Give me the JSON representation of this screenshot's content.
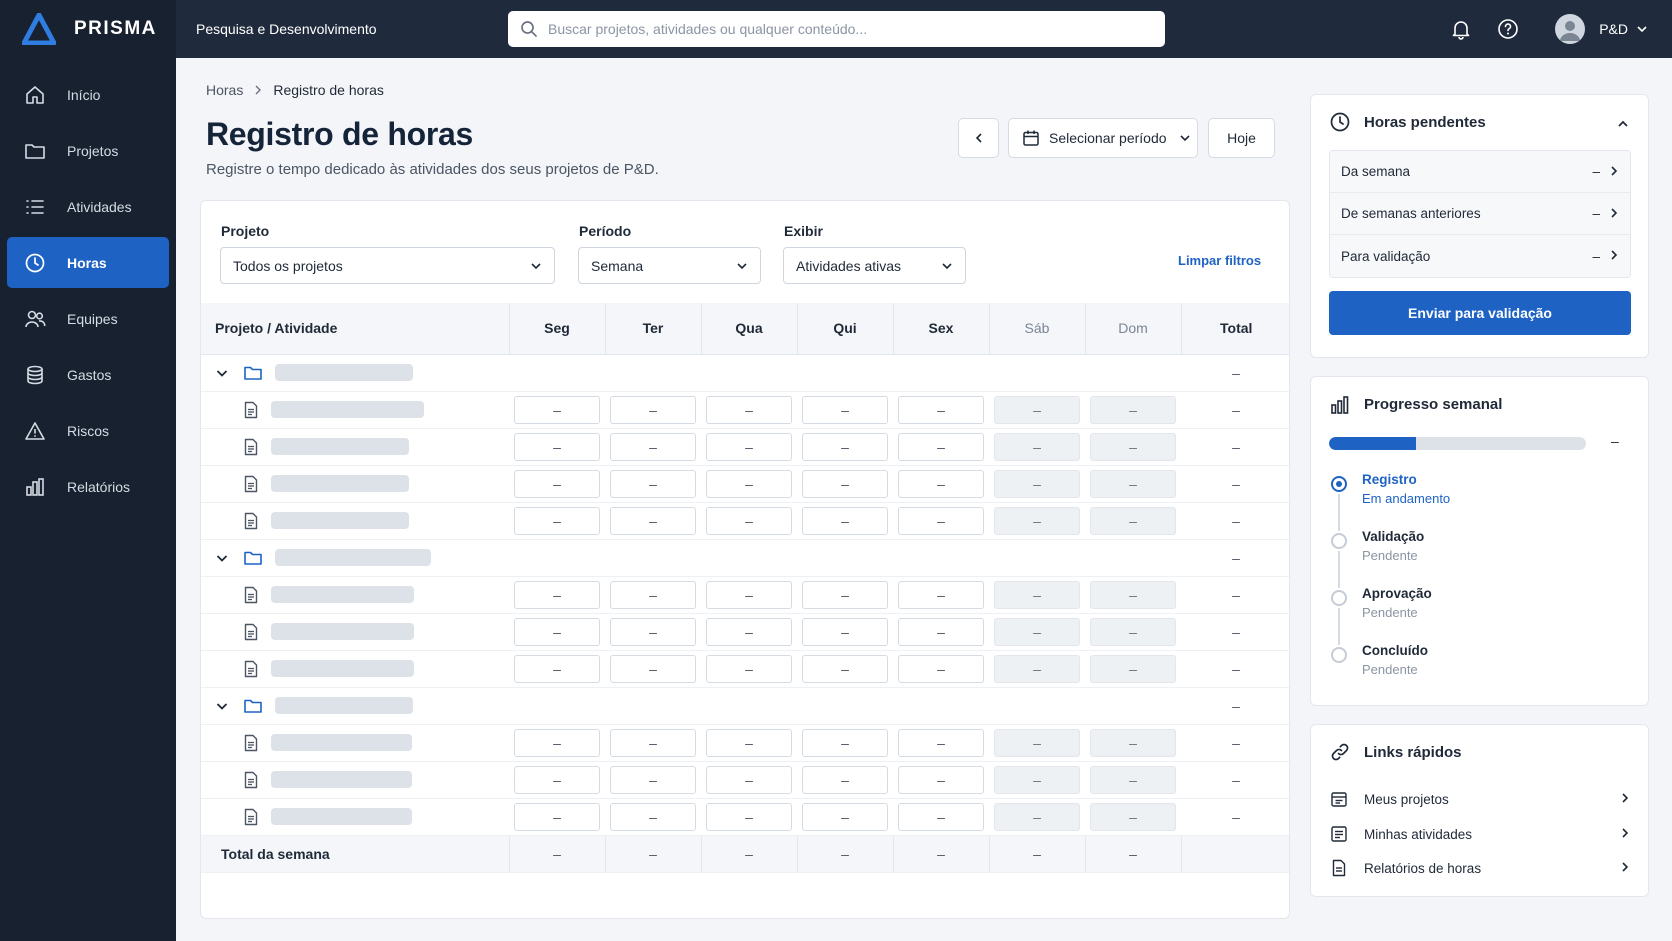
{
  "app": {
    "brand": "PRISMA",
    "org": "Pesquisa e Desenvolvimento",
    "brand_color": "#1e63c4"
  },
  "search": {
    "placeholder": "Buscar projetos, atividades ou qualquer conteúdo..."
  },
  "user": {
    "name": "P&D"
  },
  "icons": {
    "notifications": "bell-icon",
    "help": "help-circle-icon",
    "avatar": "user-avatar-icon"
  },
  "sidebar": {
    "items": [
      {
        "label": "Início",
        "icon": "home-icon"
      },
      {
        "label": "Projetos",
        "icon": "folder-icon"
      },
      {
        "label": "Atividades",
        "icon": "list-icon"
      },
      {
        "label": "Horas",
        "icon": "clock-icon",
        "active": true
      },
      {
        "label": "Equipes",
        "icon": "users-icon"
      },
      {
        "label": "Gastos",
        "icon": "database-icon"
      },
      {
        "label": "Riscos",
        "icon": "warning-icon"
      },
      {
        "label": "Relatórios",
        "icon": "bar-chart-icon"
      }
    ]
  },
  "breadcrumb": {
    "parent": "Horas",
    "current": "Registro de horas"
  },
  "page": {
    "title": "Registro de horas",
    "subtitle": "Registre o tempo dedicado às atividades dos seus projetos de P&D."
  },
  "toolbar": {
    "period_label": "Selecionar período",
    "today_label": "Hoje"
  },
  "filters": {
    "project": {
      "label": "Projeto",
      "value": "Todos os projetos"
    },
    "period": {
      "label": "Período",
      "value": "Semana"
    },
    "show": {
      "label": "Exibir",
      "value": "Atividades ativas"
    },
    "clear_label": "Limpar filtros"
  },
  "table": {
    "first_header": "Projeto / Atividade",
    "days": [
      "Seg",
      "Ter",
      "Qua",
      "Qui",
      "Sex",
      "Sáb",
      "Dom"
    ],
    "total_header": "Total",
    "empty": "–",
    "groups": [
      {
        "activities": 4
      },
      {
        "activities": 3
      },
      {
        "activities": 3
      }
    ],
    "total_row_label": "Total da semana"
  },
  "pending": {
    "title": "Horas pendentes",
    "rows": [
      {
        "label": "Da semana",
        "value": "–"
      },
      {
        "label": "De semanas anteriores",
        "value": "–"
      },
      {
        "label": "Para validação",
        "value": "–"
      }
    ],
    "submit_label": "Enviar para validação"
  },
  "progress": {
    "title": "Progresso semanal",
    "value_text": "–",
    "fill_fraction": 0.34,
    "steps": [
      {
        "title": "Registro",
        "status": "Em andamento",
        "active": true
      },
      {
        "title": "Validação",
        "status": "Pendente"
      },
      {
        "title": "Aprovação",
        "status": "Pendente"
      },
      {
        "title": "Concluído",
        "status": "Pendente"
      }
    ]
  },
  "quick_links": {
    "title": "Links rápidos",
    "items": [
      {
        "label": "Meus projetos",
        "icon": "projects-calendar-icon"
      },
      {
        "label": "Minhas atividades",
        "icon": "activities-list-icon"
      },
      {
        "label": "Relatórios de horas",
        "icon": "report-document-icon"
      }
    ]
  }
}
